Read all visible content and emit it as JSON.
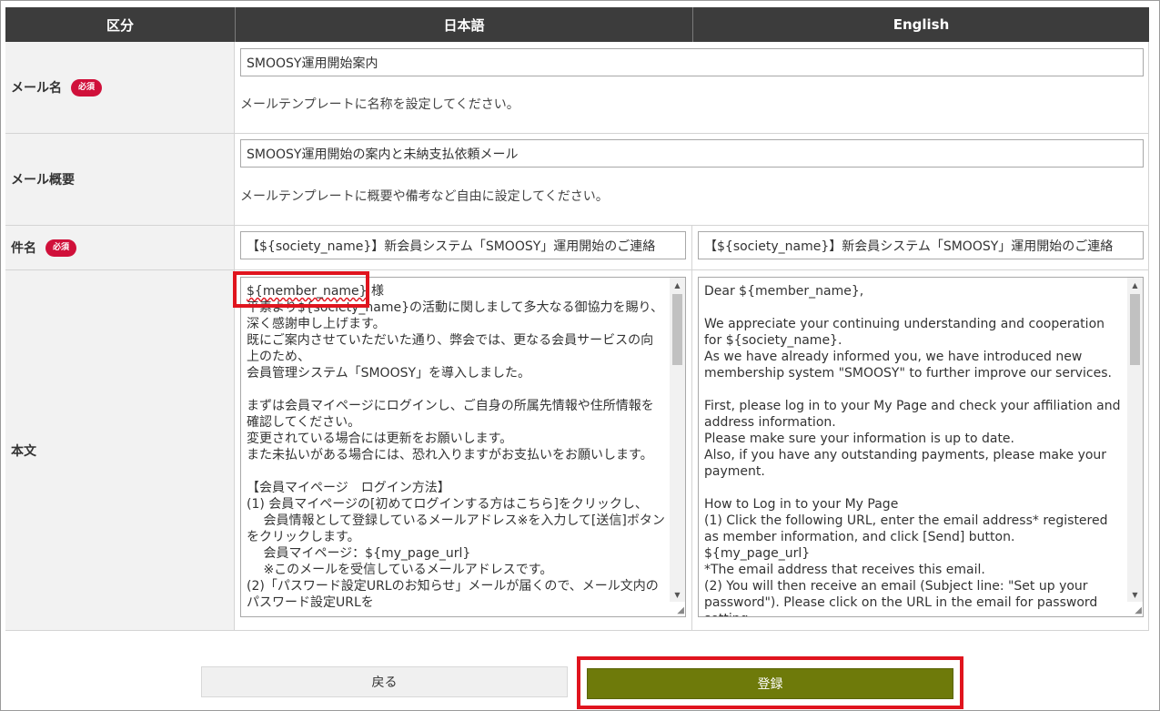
{
  "table": {
    "headers": {
      "section": "区分",
      "japanese": "日本語",
      "english": "English"
    },
    "required_badge": "必須",
    "rows": {
      "mail_name": {
        "label": "メール名",
        "value": "SMOOSY運用開始案内",
        "hint": "メールテンプレートに名称を設定してください。"
      },
      "mail_summary": {
        "label": "メール概要",
        "value": "SMOOSY運用開始の案内と未納支払依頼メール",
        "hint": "メールテンプレートに概要や備考など自由に設定してください。"
      },
      "subject": {
        "label": "件名",
        "value_ja": "【${society_name}】新会員システム「SMOOSY」運用開始のご連絡",
        "value_en": "【${society_name}】新会員システム「SMOOSY」運用開始のご連絡"
      },
      "body": {
        "label": "本文",
        "ja_first_token": "${member_name}",
        "ja_first_suffix": " 様",
        "ja_rest": "\n平素より${society_name}の活動に関しまして多大なる御協力を賜り、深く感謝申し上げます。\n既にご案内させていただいた通り、弊会では、更なる会員サービスの向上のため、\n会員管理システム「SMOOSY」を導入しました。\n\nまずは会員マイページにログインし、ご自身の所属先情報や住所情報を確認してください。\n変更されている場合には更新をお願いします。\nまた未払いがある場合には、恐れ入りますがお支払いをお願いします。\n\n【会員マイページ　ログイン方法】\n(1) 会員マイページの[初めてログインする方はこちら]をクリックし、\n　 会員情報として登録しているメールアドレス※を入力して[送信]ボタンをクリックします。\n　 会員マイページ：${my_page_url}\n　 ※このメールを受信しているメールアドレスです。\n(2)「パスワード設定URLのお知らせ」メールが届くので、メール文内のパスワード設定URLを",
        "en": "Dear ${member_name},\n\nWe appreciate your continuing understanding and cooperation for ${society_name}.\nAs we have already informed you, we have introduced new membership system \"SMOOSY\" to further improve our services.\n\nFirst, please log in to your My Page and check your affiliation and address information.\nPlease make sure your information is up to date.\nAlso, if you have any outstanding payments, please make your payment.\n\nHow to Log in to your My Page\n(1) Click the following URL, enter the email address* registered as member information, and click [Send] button.\n${my_page_url}\n*The email address that receives this email.\n(2) You will then receive an email (Subject line: \"Set up your password\"). Please click on the URL in the email for password setting."
      }
    }
  },
  "buttons": {
    "back": "戻る",
    "submit": "登録"
  },
  "colors": {
    "header_bg": "#3c3c3c",
    "required_badge": "#d0103a",
    "submit_bg": "#6e7a0a",
    "highlight_box": "#e0141e"
  }
}
